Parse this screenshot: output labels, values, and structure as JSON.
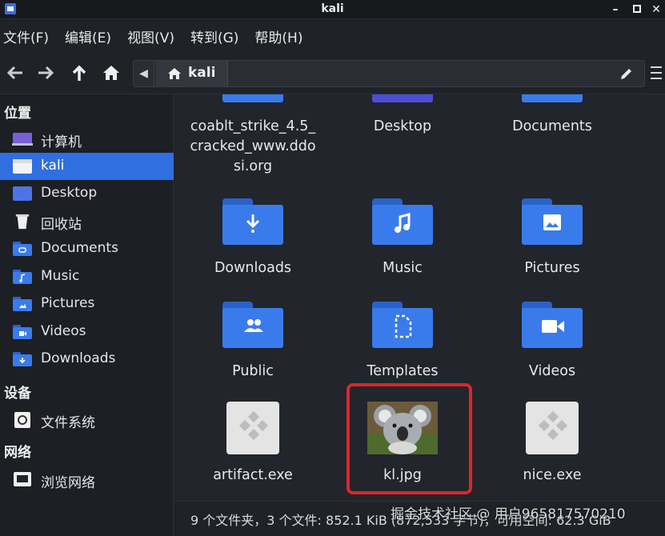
{
  "window": {
    "title": "kali"
  },
  "menu": [
    "文件(F)",
    "编辑(E)",
    "视图(V)",
    "转到(G)",
    "帮助(H)"
  ],
  "path": {
    "segment": "kali"
  },
  "sidebar": {
    "places_header": "位置",
    "places": [
      {
        "label": "计算机",
        "icon": "computer-icon"
      },
      {
        "label": "kali",
        "icon": "home-folder-icon",
        "selected": true
      },
      {
        "label": "Desktop",
        "icon": "desktop-folder-icon"
      },
      {
        "label": "回收站",
        "icon": "trash-icon"
      },
      {
        "label": "Documents",
        "icon": "documents-folder-icon"
      },
      {
        "label": "Music",
        "icon": "music-folder-icon"
      },
      {
        "label": "Pictures",
        "icon": "pictures-folder-icon"
      },
      {
        "label": "Videos",
        "icon": "videos-folder-icon"
      },
      {
        "label": "Downloads",
        "icon": "downloads-folder-icon"
      }
    ],
    "devices_header": "设备",
    "devices": [
      {
        "label": "文件系统",
        "icon": "drive-icon"
      }
    ],
    "network_header": "网络",
    "network": [
      {
        "label": "浏览网络",
        "icon": "network-icon"
      }
    ]
  },
  "files": {
    "top_row": [
      {
        "name_lines": [
          "coablt_strike_4.5_",
          "cracked_www.ddo",
          "si.org"
        ]
      },
      {
        "name_lines": [
          "Desktop"
        ]
      },
      {
        "name_lines": [
          "Documents"
        ]
      }
    ],
    "row2": [
      {
        "name": "Downloads",
        "icon": "download-glyph-icon"
      },
      {
        "name": "Music",
        "icon": "music-note-icon"
      },
      {
        "name": "Pictures",
        "icon": "image-glyph-icon"
      }
    ],
    "row3": [
      {
        "name": "Public",
        "icon": "people-glyph-icon"
      },
      {
        "name": "Templates",
        "icon": "template-glyph-icon"
      },
      {
        "name": "Videos",
        "icon": "video-camera-icon"
      }
    ],
    "row4": [
      {
        "name": "artifact.exe",
        "icon": "executable-icon"
      },
      {
        "name": "kl.jpg",
        "icon": "koala-thumbnail"
      },
      {
        "name": "nice.exe",
        "icon": "executable-icon"
      }
    ]
  },
  "status": "9 个文件夹，3 个文件: 852.1 KiB (872,533 字节)，可用空间: 62.3 GiB",
  "watermark": "掘金技术社区 @ 用户965817570210",
  "colors": {
    "accent": "#2f6fe0",
    "folder": "#3a7bec",
    "highlight": "#e0242a"
  }
}
